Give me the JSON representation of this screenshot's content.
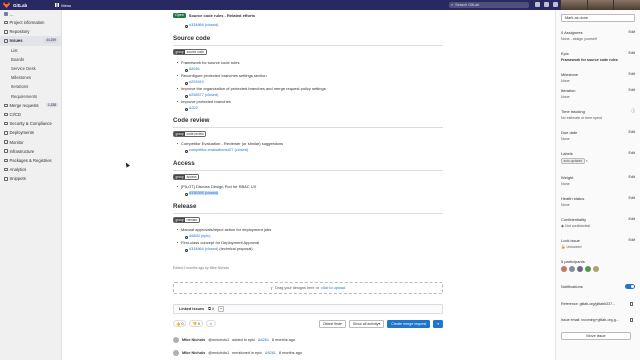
{
  "topbar": {
    "brand": "GitLab",
    "menu_label": "Menu",
    "search_placeholder": "Search GitLab"
  },
  "sidebar": {
    "context": "...",
    "items": [
      {
        "label": "Project information"
      },
      {
        "label": "Repository"
      },
      {
        "label": "Issues",
        "badge": "44,269"
      },
      {
        "label": "Merge requests",
        "badge": "1,338"
      },
      {
        "label": "CI/CD"
      },
      {
        "label": "Security & Compliance"
      },
      {
        "label": "Deployments"
      },
      {
        "label": "Monitor"
      },
      {
        "label": "Infrastructure"
      },
      {
        "label": "Packages & Registries"
      },
      {
        "label": "Analytics"
      },
      {
        "label": "Snippets"
      }
    ],
    "issues_sub": [
      "List",
      "Boards",
      "Service Desk",
      "Milestones",
      "Iterations",
      "Requirements"
    ]
  },
  "main": {
    "state": "Open",
    "sticky_title": "Source code rules - Related efforts",
    "top_link": "#334866 (closed)",
    "sections": [
      {
        "heading": "Source code",
        "label_key": "group",
        "label_val": "source code",
        "items": [
          {
            "text": "Framework for source code rules",
            "link": "&8261"
          },
          {
            "text": "Reconfigure protected branches settings section",
            "link": "#293919"
          },
          {
            "text": "Improve the organization of protected branches and merge request policy settings",
            "link": "#258577 (closed)"
          },
          {
            "text": "Improve protected branches",
            "link": "&322"
          }
        ]
      },
      {
        "heading": "Code review",
        "label_key": "group",
        "label_val": "code review",
        "items": [
          {
            "text": "Competitor Evaluation - Reviewer (or similar) suggestions",
            "link": "competitor-evaluations#27 (closed)"
          }
        ]
      },
      {
        "heading": "Access",
        "label_key": "group",
        "label_val": "access",
        "items": [
          {
            "text": "[PILOT] Discuss Design Pod for RBAC UX",
            "link": "#336395 (closed)"
          }
        ]
      },
      {
        "heading": "Release",
        "label_key": "group",
        "label_val": "release",
        "items": [
          {
            "text": "Manual approvals/reject action for deployment jobs",
            "link": "&6832 (epic)"
          },
          {
            "text": "First-class concept for Deployment Approval",
            "link": "#334864 (closed)",
            "suffix": "(technical proposal)"
          }
        ]
      }
    ],
    "edited": "Edited 2 months ago by Mike Nichols",
    "drop_text": "Drag your designs here or",
    "drop_link": "click to upload.",
    "linked_issues": "Linked issues",
    "linked_count": "0",
    "reactions": [
      {
        "emoji": "👍",
        "count": "0"
      },
      {
        "emoji": "👎",
        "count": "0"
      }
    ],
    "oldest_first": "Oldest first",
    "show_all_activity": "Show all activity",
    "create_mr": "Create merge request",
    "activity": [
      {
        "author": "Mike Nichols",
        "handle": "@mnichols1",
        "action": "added to epic",
        "link": "&8261",
        "time": "8 months ago"
      },
      {
        "author": "Mike Nichols",
        "handle": "@mnichols1",
        "action": "mentioned in epic",
        "link": "&8261",
        "time": "8 months ago"
      }
    ]
  },
  "right_sidebar": {
    "mark_done": "Mark as done",
    "blocks": [
      {
        "title": "0 Assignees",
        "value": "None - assign yourself",
        "edit": "Edit"
      },
      {
        "title": "Epic",
        "value": "Framework for source code rules",
        "edit": "Edit"
      },
      {
        "title": "Milestone",
        "value": "None",
        "edit": "Edit"
      },
      {
        "title": "Iteration",
        "value": "None",
        "edit": "Edit"
      },
      {
        "title": "Time tracking",
        "value": "No estimate or time spent",
        "edit": ""
      },
      {
        "title": "Due date",
        "value": "None",
        "edit": "Edit"
      },
      {
        "title": "Labels",
        "value": "auto updated",
        "edit": "Edit"
      },
      {
        "title": "Weight",
        "value": "None",
        "edit": "Edit"
      },
      {
        "title": "Health status",
        "value": "None",
        "edit": "Edit"
      },
      {
        "title": "Confidentiality",
        "value": "Not confidential",
        "edit": "Edit"
      },
      {
        "title": "Lock issue",
        "value": "Unlocked",
        "edit": "Edit"
      },
      {
        "title": "5 participants",
        "value": "",
        "edit": ""
      },
      {
        "title": "Notifications",
        "value": "",
        "edit": ""
      },
      {
        "title": "Reference: gitlab-org/gitlab#337...",
        "value": "",
        "edit": ""
      },
      {
        "title": "Issue email: incoming+gitlab-org-g...",
        "value": "",
        "edit": ""
      }
    ],
    "move_issue": "Move issue"
  },
  "colors": {
    "topbar": "#292961",
    "accent": "#1f75cb",
    "open": "#1f7a3f"
  }
}
